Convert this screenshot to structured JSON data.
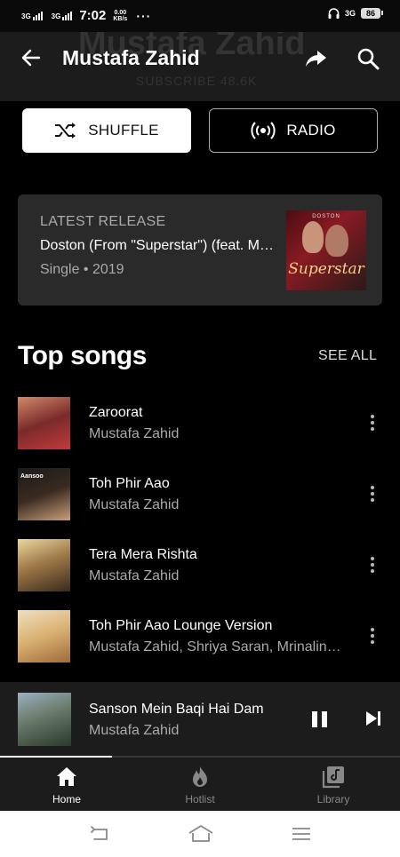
{
  "status_bar": {
    "net1": "3G",
    "net2": "3G",
    "time": "7:02",
    "speed_value": "0.00",
    "speed_unit": "KB/s",
    "more": "···",
    "right_net": "3G",
    "battery": "86"
  },
  "header": {
    "title": "Mustafa Zahid",
    "bg_title": "Mustafa Zahid",
    "bg_subscribe": "SUBSCRIBE  48.6K"
  },
  "actions": {
    "shuffle_label": "SHUFFLE",
    "radio_label": "RADIO"
  },
  "latest_release": {
    "label": "LATEST RELEASE",
    "title": "Doston (From \"Superstar\") (feat. Mustafa Zahid)",
    "meta": "Single • 2019",
    "art_top": "DOSTON",
    "art_text": "Superstar"
  },
  "top_songs": {
    "title": "Top songs",
    "see_all": "SEE ALL",
    "songs": [
      {
        "title": "Zaroorat",
        "artist": "Mustafa Zahid",
        "thumb_text": ""
      },
      {
        "title": "Toh Phir Aao",
        "artist": "Mustafa Zahid",
        "thumb_text": "Aansoo"
      },
      {
        "title": "Tera Mera Rishta",
        "artist": "Mustafa Zahid",
        "thumb_text": ""
      },
      {
        "title": "Toh Phir Aao Lounge Version",
        "artist": "Mustafa Zahid, Shriya Saran, Mrinalini Tyagi",
        "thumb_text": ""
      }
    ]
  },
  "player": {
    "title": "Sanson Mein Baqi Hai Dam",
    "artist": "Mustafa Zahid",
    "progress_fraction": 0.28
  },
  "nav": {
    "home": "Home",
    "hotlist": "Hotlist",
    "library": "Library"
  },
  "colors": {
    "background": "#000000",
    "surface": "#1c1c1c",
    "card": "#2a2a2a",
    "secondary_text": "#aaaaaa"
  }
}
